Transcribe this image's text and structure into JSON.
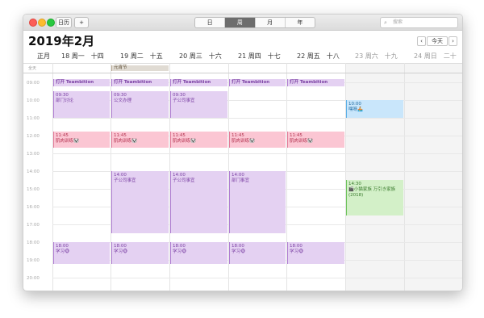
{
  "toolbar": {
    "calendars_label": "日历",
    "add_label": "+",
    "search_placeholder": "搜索"
  },
  "views": {
    "day": "日",
    "week": "周",
    "month": "月",
    "year": "年"
  },
  "title": "2019年2月",
  "nav": {
    "prev": "‹",
    "today": "今天",
    "next": "›"
  },
  "day_headers": [
    {
      "label": "正月",
      "muted": false
    },
    {
      "label": "18 周一　十四",
      "muted": false
    },
    {
      "label": "19 周二　十五",
      "muted": false
    },
    {
      "label": "20 周三　十六",
      "muted": false
    },
    {
      "label": "21 周四　十七",
      "muted": false
    },
    {
      "label": "22 周五　十八",
      "muted": false
    },
    {
      "label": "23 周六　十九",
      "muted": true
    },
    {
      "label": "24 周日　二十",
      "muted": true
    }
  ],
  "allday_label": "全天",
  "allday_event": "元宵节",
  "hours": [
    "09:00",
    "10:00",
    "11:00",
    "12:00",
    "13:00",
    "14:00",
    "15:00",
    "16:00",
    "17:00",
    "18:00",
    "19:00",
    "20:00"
  ],
  "events": {
    "teambition": "打开 Teambition",
    "mon_0930_time": "09:30",
    "mon_0930_title": "部门讨论",
    "tue_0930_time": "09:30",
    "tue_0930_title": "公文办理",
    "wed_0930_time": "09:30",
    "wed_0930_title": "子公司事宜",
    "sat_1000_time": "10:00",
    "sat_1000_title": "嘿呀🚣",
    "fitness_time": "11:45",
    "fitness_title": "肌肉训练🐼",
    "tue_1400_time": "14:00",
    "tue_1400_title": "子公司事宜",
    "wed_1400_time": "14:00",
    "wed_1400_title": "子公司事宜",
    "thu_1400_time": "14:00",
    "thu_1400_title": "部门事宜",
    "sat_1430_time": "14:30",
    "sat_1430_title": "🎬小猫家族 万引き家族 (2018)",
    "study_time": "18:00",
    "study_title": "学习🐵"
  },
  "colors": {
    "study_work": "#e4d1f2",
    "fitness": "#fbc6d3",
    "sat_morning": "#c9e6fb",
    "movie": "#d3f0c8",
    "holiday": "#e0dbd3"
  }
}
